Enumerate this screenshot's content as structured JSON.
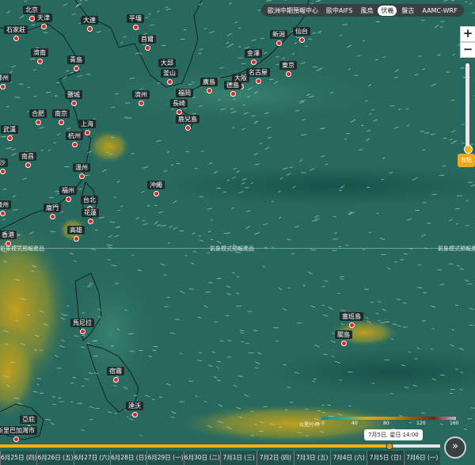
{
  "model_tabs": [
    {
      "label": "歐洲中期預報中心",
      "active": false
    },
    {
      "label": "歐中AIFS",
      "active": false
    },
    {
      "label": "風烏",
      "active": false
    },
    {
      "label": "伏羲",
      "active": true
    },
    {
      "label": "盤古",
      "active": false
    },
    {
      "label": "AAMC-WRF",
      "active": false
    }
  ],
  "zoom": {
    "in": "+",
    "out": "−",
    "level_label": "有點",
    "level_fraction": 0.08
  },
  "source_notes": [
    "氣象模式預報產品",
    "氣象模式預報產品",
    "氣象模式預報產品"
  ],
  "cities": [
    {
      "name": "北京"
    },
    {
      "name": "天津"
    },
    {
      "name": "石家莊"
    },
    {
      "name": "大連"
    },
    {
      "name": "平壤"
    },
    {
      "name": "首爾"
    },
    {
      "name": "新潟"
    },
    {
      "name": "仙台"
    },
    {
      "name": "濟南"
    },
    {
      "name": "青島"
    },
    {
      "name": "大邱"
    },
    {
      "name": "釜山"
    },
    {
      "name": "金澤"
    },
    {
      "name": "東京"
    },
    {
      "name": "名古屋"
    },
    {
      "name": "大阪"
    },
    {
      "name": "廣島"
    },
    {
      "name": "德島"
    },
    {
      "name": "福岡"
    },
    {
      "name": "鄭州"
    },
    {
      "name": "鹽城"
    },
    {
      "name": "濟州"
    },
    {
      "name": "長崎"
    },
    {
      "name": "合肥"
    },
    {
      "name": "南京"
    },
    {
      "name": "鹿兒島"
    },
    {
      "name": "武漢"
    },
    {
      "name": "上海"
    },
    {
      "name": "杭州"
    },
    {
      "name": "南昌"
    },
    {
      "name": "沙"
    },
    {
      "name": "溫州"
    },
    {
      "name": "沖繩"
    },
    {
      "name": "福州"
    },
    {
      "name": "台北"
    },
    {
      "name": "花蓮"
    },
    {
      "name": "廈門"
    },
    {
      "name": "廣州"
    },
    {
      "name": "高雄"
    },
    {
      "name": "香港"
    },
    {
      "name": "馬尼拉"
    },
    {
      "name": "塞班島"
    },
    {
      "name": "關島"
    },
    {
      "name": "宿霧"
    },
    {
      "name": "達沃"
    },
    {
      "name": "亞庇"
    },
    {
      "name": "斯里巴加灣市"
    }
  ],
  "legend": {
    "unit": "公里/小時",
    "ticks": [
      "0",
      "40",
      "80",
      "120",
      "160"
    ],
    "colors": [
      "#1e8a8a",
      "#3fa28f",
      "#c8b21e",
      "#d88a1a",
      "#b34b1a",
      "#8a1a1a",
      "#b8b8c4"
    ]
  },
  "timeline": {
    "tooltip": "7月5日, 星日 14:00",
    "progress_fraction": 0.885,
    "days": [
      "6月25日 (四)",
      "6月26日 (五)",
      "6月27日 (六)",
      "6月28日 (日)",
      "6月29日 (一)",
      "6月30日 (二)",
      "7月1日 (三)",
      "7月2日 (四)",
      "7月3日 (五)",
      "7月4日 (六)",
      "7月5日 (日)",
      "7月6日 (一)"
    ],
    "current_index": 10,
    "play_icon": "»"
  }
}
